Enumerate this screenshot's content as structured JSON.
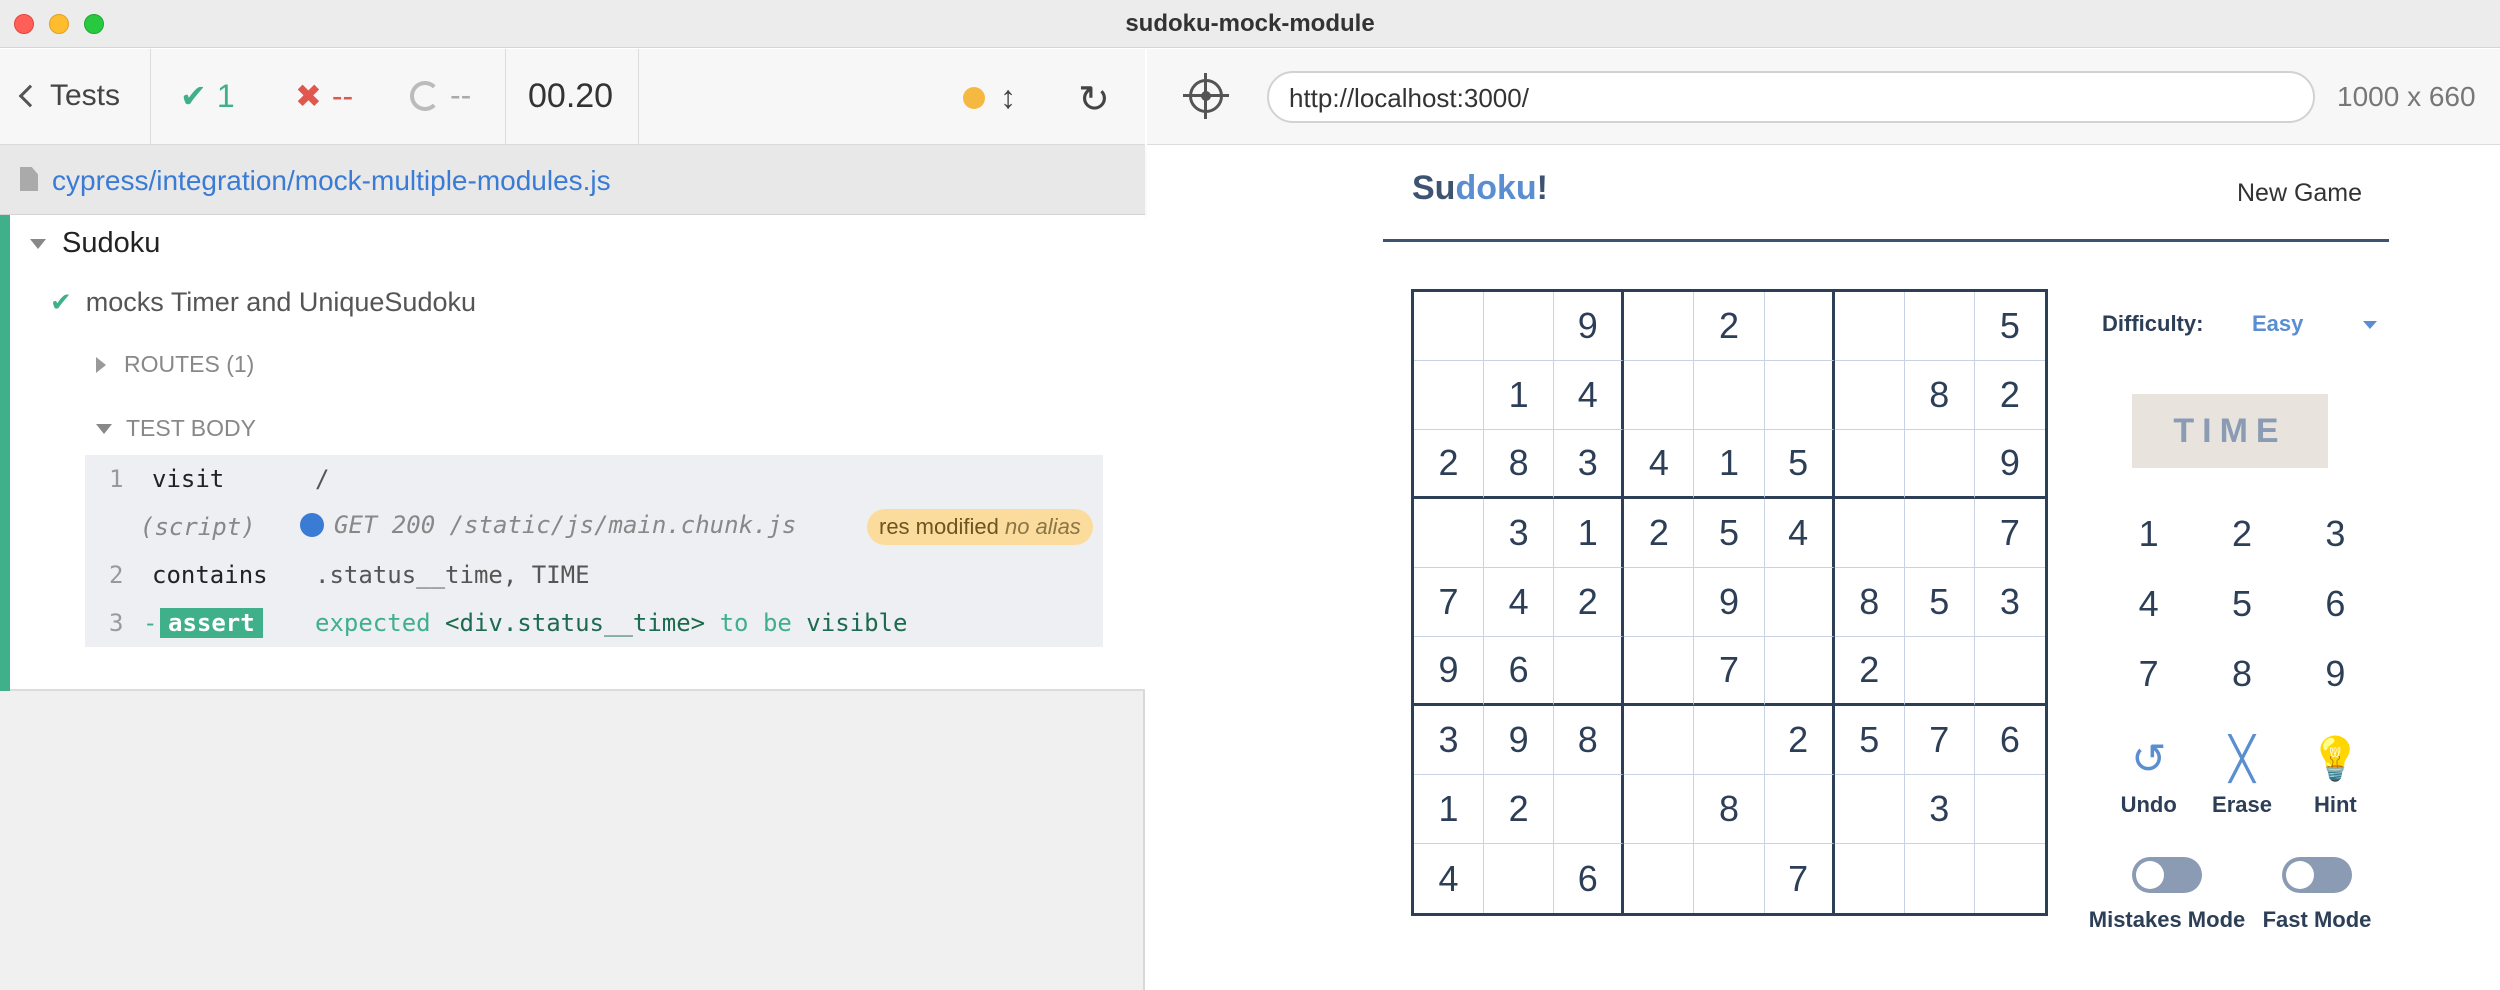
{
  "window": {
    "title": "sudoku-mock-module"
  },
  "reporter": {
    "tests_label": "Tests",
    "passed": "1",
    "failed": "--",
    "pending": "--",
    "duration": "00.20",
    "spec_path": "cypress/integration/mock-multiple-modules.js",
    "suite_title": "Sudoku",
    "test_title": "mocks Timer and UniqueSudoku",
    "routes_label": "ROUTES (1)",
    "test_body_label": "TEST BODY",
    "commands": [
      {
        "num": "1",
        "name": "visit",
        "message": "/"
      },
      {
        "num": "",
        "name": "(script)",
        "message": "GET 200 /static/js/main.chunk.js",
        "badge_main": "res modified",
        "badge_alias": "no alias"
      },
      {
        "num": "2",
        "name": "contains",
        "message": ".status__time, TIME"
      },
      {
        "num": "3",
        "name": "-assert",
        "label": "assert",
        "message_parts": [
          "expected",
          "<div.status__time>",
          "to be",
          "visible"
        ]
      }
    ],
    "colors": {
      "pass": "#3fb08a",
      "fail": "#e0574e",
      "link": "#3a7bd5",
      "running_dot": "#f5b942"
    }
  },
  "aut_header": {
    "url": "http://localhost:3000/",
    "viewport": "1000 x 660"
  },
  "app": {
    "logo_part1": "Su",
    "logo_part2": "doku",
    "logo_part3": "!",
    "new_game": "New Game",
    "difficulty_label": "Difficulty:",
    "difficulty_value": "Easy",
    "time_label": "TIME",
    "grid": [
      [
        "",
        "",
        "9",
        "",
        "2",
        "",
        "",
        "",
        "5"
      ],
      [
        "",
        "1",
        "4",
        "",
        "",
        "",
        "",
        "8",
        "2"
      ],
      [
        "2",
        "8",
        "3",
        "4",
        "1",
        "5",
        "",
        "",
        "9"
      ],
      [
        "",
        "3",
        "1",
        "2",
        "5",
        "4",
        "",
        "",
        "7"
      ],
      [
        "7",
        "4",
        "2",
        "",
        "9",
        "",
        "8",
        "5",
        "3"
      ],
      [
        "9",
        "6",
        "",
        "",
        "7",
        "",
        "2",
        "",
        ""
      ],
      [
        "3",
        "9",
        "8",
        "",
        "",
        "2",
        "5",
        "7",
        "6"
      ],
      [
        "1",
        "2",
        "",
        "",
        "8",
        "",
        "",
        "3",
        ""
      ],
      [
        "4",
        "",
        "6",
        "",
        "",
        "7",
        "",
        "",
        ""
      ]
    ],
    "numpad": [
      "1",
      "2",
      "3",
      "4",
      "5",
      "6",
      "7",
      "8",
      "9"
    ],
    "actions": [
      {
        "label": "Undo",
        "icon": "undo-icon"
      },
      {
        "label": "Erase",
        "icon": "erase-icon"
      },
      {
        "label": "Hint",
        "icon": "hint-icon"
      }
    ],
    "toggles": [
      {
        "label": "Mistakes Mode",
        "on": false
      },
      {
        "label": "Fast Mode",
        "on": false
      }
    ]
  }
}
